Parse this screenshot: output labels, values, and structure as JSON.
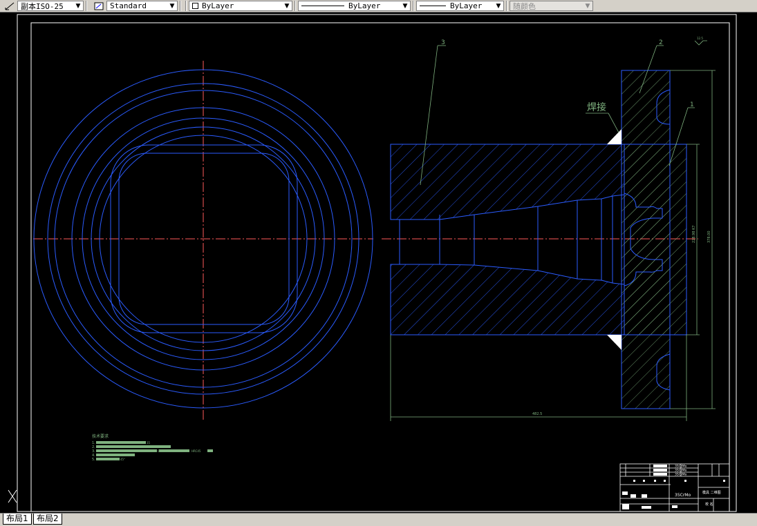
{
  "toolbar": {
    "dimstyle": "副本ISO-25",
    "textstyle": "Standard",
    "layer": "ByLayer",
    "linetype": "ByLayer",
    "lineweight": "ByLayer",
    "color": "随颜色"
  },
  "drawing": {
    "weld_label": "焊接",
    "balloon_1": "1",
    "balloon_2": "2",
    "balloon_3": "3",
    "dim_length": "482.5",
    "dim_outer": "378.00",
    "dim_inner": "228.98 K7",
    "roughness": "12.5",
    "notes_title": "技术要求",
    "notes": [
      "1.",
      "2.",
      "3.",
      "4.",
      "5."
    ],
    "note_text_1": "35",
    "note_text_3": "0.8~1.2mm",
    "note_text_3b": "HRC45",
    "note_text_5": "45°",
    "titleblock": {
      "material": "35CrMo",
      "name": "模具 二维图",
      "rows": [
        "35CrMo",
        "35CrMo",
        "35CrMo"
      ],
      "school": "校  名"
    }
  },
  "tabs": [
    "布局1",
    "布局2"
  ],
  "colors": {
    "blue": "#2b5cff",
    "green": "#7fb27f",
    "red_center": "#ff5a5a",
    "white": "#ffffff"
  }
}
